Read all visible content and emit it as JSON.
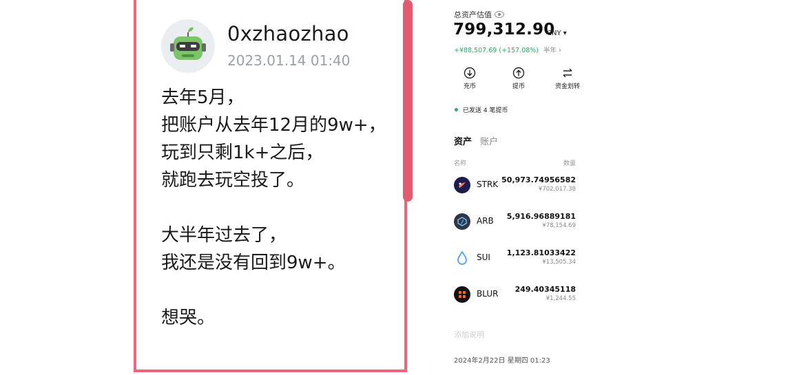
{
  "post": {
    "username": "0xzhaozhao",
    "timestamp": "2023.01.14 01:40",
    "lines": [
      "去年5月，",
      "把账户从去年12月的9w+，",
      "玩到只剩1k+之后，",
      "就跑去玩空投了。",
      "",
      "大半年过去了，",
      "我还是没有回到9w+。",
      "",
      "想哭。"
    ],
    "avatar_icon": "robot-avatar-icon",
    "accent_color": "#e8677a"
  },
  "wallet": {
    "total_label": "总资产估值",
    "total_value": "799,312.90",
    "currency": "CNY",
    "change": "+¥88,507.69 (+157.08%)",
    "period": "半年 ›",
    "actions": [
      {
        "label": "充币",
        "icon": "deposit-icon"
      },
      {
        "label": "提币",
        "icon": "withdraw-icon"
      },
      {
        "label": "资金划转",
        "icon": "transfer-icon"
      }
    ],
    "notice": "已发送 4 笔提币",
    "tabs": [
      "资产",
      "账户"
    ],
    "columns": {
      "name": "名称",
      "qty": "数量"
    },
    "assets": [
      {
        "symbol": "STRK",
        "qty": "50,973.74956582",
        "value": "¥702,017.38",
        "icon": "strk-logo-icon"
      },
      {
        "symbol": "ARB",
        "qty": "5,916.96889181",
        "value": "¥78,154.69",
        "icon": "arb-logo-icon"
      },
      {
        "symbol": "SUI",
        "qty": "1,123.81033422",
        "value": "¥13,505.34",
        "icon": "sui-logo-icon"
      },
      {
        "symbol": "BLUR",
        "qty": "249.40345118",
        "value": "¥1,244.55",
        "icon": "blur-logo-icon"
      }
    ],
    "memo_placeholder": "添加说明",
    "date": "2024年2月22日 星期四 01:23",
    "positive_color": "#2eaa6a"
  }
}
